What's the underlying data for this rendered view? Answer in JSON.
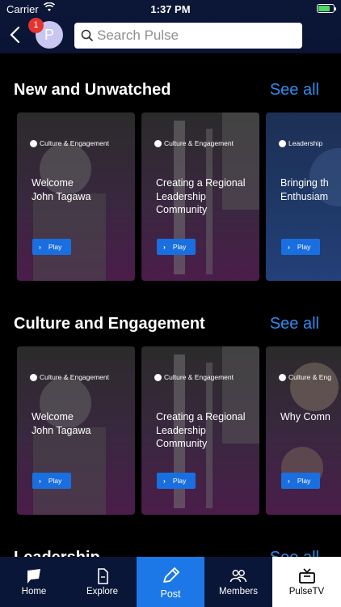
{
  "status": {
    "carrier": "Carrier",
    "time": "1:37 PM"
  },
  "header": {
    "avatar_initial": "P",
    "badge_count": "1",
    "search_placeholder": "Search Pulse"
  },
  "sections": [
    {
      "title": "New and Unwatched",
      "see_all": "See all",
      "cards": [
        {
          "tag": "Culture & Engagement",
          "title": "Welcome\nJohn Tagawa",
          "play": "Play"
        },
        {
          "tag": "Culture & Engagement",
          "title": "Creating a Regional\nLeadership\nCommunity",
          "play": "Play"
        },
        {
          "tag": "Leadership",
          "title": "Bringing th\nEnthusiam",
          "play": "Play"
        }
      ]
    },
    {
      "title": "Culture and Engagement",
      "see_all": "See all",
      "cards": [
        {
          "tag": "Culture & Engagement",
          "title": "Welcome\nJohn Tagawa",
          "play": "Play"
        },
        {
          "tag": "Culture & Engagement",
          "title": "Creating a Regional\nLeadership\nCommunity",
          "play": "Play"
        },
        {
          "tag": "Culture & Eng",
          "title": "Why Comn",
          "play": "Play"
        }
      ]
    },
    {
      "title": "Leadership",
      "see_all": "See all"
    }
  ],
  "tabs": [
    {
      "label": "Home",
      "icon": "flag-icon"
    },
    {
      "label": "Explore",
      "icon": "document-icon"
    },
    {
      "label": "Post",
      "icon": "pencil-icon"
    },
    {
      "label": "Members",
      "icon": "people-icon"
    },
    {
      "label": "PulseTV",
      "icon": "tv-icon"
    }
  ],
  "colors": {
    "accent": "#2e8cf0",
    "header_bg": "#0c1738",
    "active_tab": "#1b78e6",
    "badge": "#e3342f"
  }
}
